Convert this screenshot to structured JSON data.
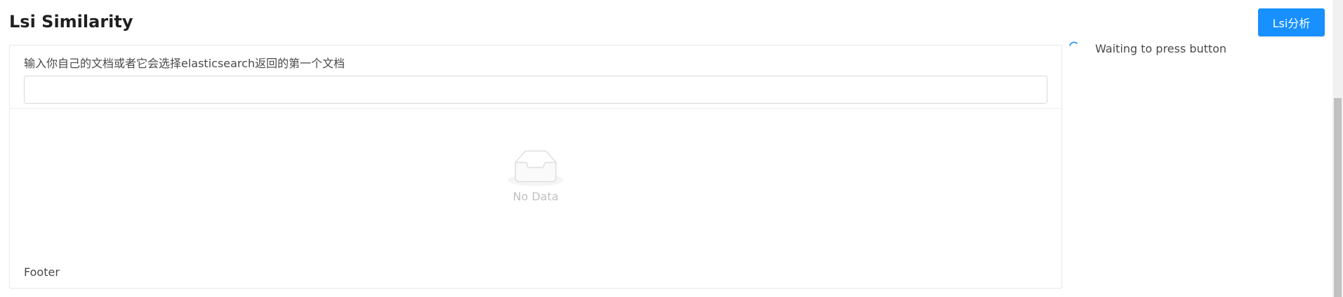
{
  "header": {
    "title": "Lsi Similarity",
    "action_button_label": "Lsi分析"
  },
  "card": {
    "input_label": "输入你自己的文档或者它会选择elasticsearch返回的第一个文档",
    "input_value": "",
    "input_placeholder": "",
    "empty_text": "No Data",
    "footer": "Footer"
  },
  "status": {
    "text": "Waiting to press button",
    "icon": "spinner-icon"
  },
  "colors": {
    "primary": "#1890ff",
    "spinner": "#1890ff",
    "border": "#e8e8e8"
  }
}
